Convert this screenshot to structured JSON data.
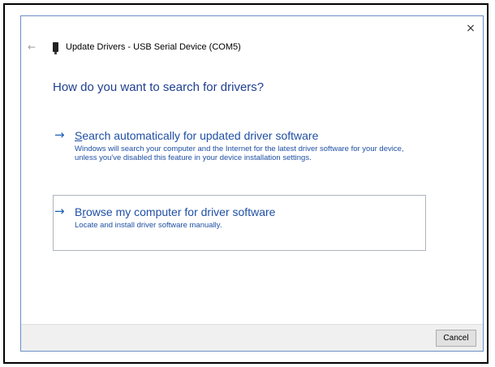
{
  "window": {
    "title": "Update Drivers - USB Serial Device (COM5)",
    "close_label": "×",
    "back_label": "←"
  },
  "heading": "How do you want to search for drivers?",
  "options": [
    {
      "arrow": "→",
      "title_access_key": "S",
      "title_rest": "earch automatically for updated driver software",
      "description": "Windows will search your computer and the Internet for the latest driver software for your device, unless you've disabled this feature in your device installation settings."
    },
    {
      "arrow": "→",
      "title_prefix": "B",
      "title_access_key": "r",
      "title_rest": "owse my computer for driver software",
      "description": "Locate and install driver software manually."
    }
  ],
  "footer": {
    "cancel_label": "Cancel"
  },
  "colors": {
    "heading": "#1f3f8f",
    "link": "#1f4fa3",
    "arrow": "#1e5fb3",
    "footer_bg": "#f0f0f0",
    "dialog_border": "#6a8fc4"
  }
}
